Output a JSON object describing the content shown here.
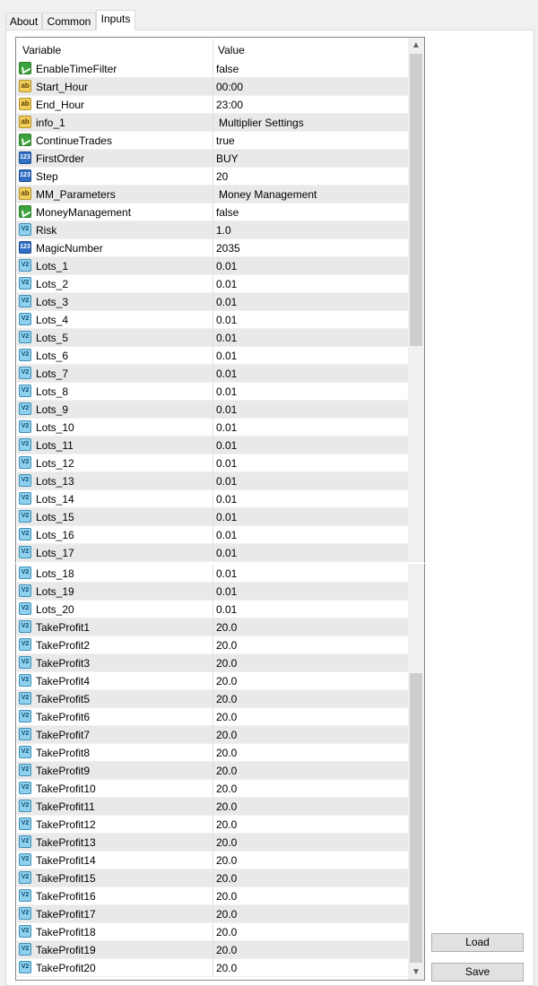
{
  "tabs": [
    {
      "label": "About"
    },
    {
      "label": "Common"
    },
    {
      "label": "Inputs"
    }
  ],
  "table": {
    "columns": [
      "Variable",
      "Value"
    ],
    "rows_top": [
      {
        "name": "EnableTimeFilter",
        "value": "false",
        "icon": "bool-icon"
      },
      {
        "name": "Start_Hour",
        "value": "00:00",
        "icon": "string-icon"
      },
      {
        "name": "End_Hour",
        "value": "23:00",
        "icon": "string-icon"
      },
      {
        "name": "info_1",
        "value": "Multiplier Settings",
        "icon": "string-icon"
      },
      {
        "name": "ContinueTrades",
        "value": "true",
        "icon": "bool-icon"
      },
      {
        "name": "FirstOrder",
        "value": "BUY",
        "icon": "int-icon"
      },
      {
        "name": "Step",
        "value": "20",
        "icon": "int-icon"
      },
      {
        "name": "MM_Parameters",
        "value": "Money Management",
        "icon": "string-icon"
      },
      {
        "name": "MoneyManagement",
        "value": "false",
        "icon": "bool-icon"
      },
      {
        "name": "Risk",
        "value": "1.0",
        "icon": "double-icon"
      },
      {
        "name": "MagicNumber",
        "value": "2035",
        "icon": "int-icon"
      },
      {
        "name": "Lots_1",
        "value": "0.01",
        "icon": "double-icon"
      },
      {
        "name": "Lots_2",
        "value": "0.01",
        "icon": "double-icon"
      },
      {
        "name": "Lots_3",
        "value": "0.01",
        "icon": "double-icon"
      },
      {
        "name": "Lots_4",
        "value": "0.01",
        "icon": "double-icon"
      },
      {
        "name": "Lots_5",
        "value": "0.01",
        "icon": "double-icon"
      },
      {
        "name": "Lots_6",
        "value": "0.01",
        "icon": "double-icon"
      },
      {
        "name": "Lots_7",
        "value": "0.01",
        "icon": "double-icon"
      },
      {
        "name": "Lots_8",
        "value": "0.01",
        "icon": "double-icon"
      },
      {
        "name": "Lots_9",
        "value": "0.01",
        "icon": "double-icon"
      },
      {
        "name": "Lots_10",
        "value": "0.01",
        "icon": "double-icon"
      },
      {
        "name": "Lots_11",
        "value": "0.01",
        "icon": "double-icon"
      },
      {
        "name": "Lots_12",
        "value": "0.01",
        "icon": "double-icon"
      },
      {
        "name": "Lots_13",
        "value": "0.01",
        "icon": "double-icon"
      },
      {
        "name": "Lots_14",
        "value": "0.01",
        "icon": "double-icon"
      },
      {
        "name": "Lots_15",
        "value": "0.01",
        "icon": "double-icon"
      },
      {
        "name": "Lots_16",
        "value": "0.01",
        "icon": "double-icon"
      },
      {
        "name": "Lots_17",
        "value": "0.01",
        "icon": "double-icon"
      }
    ],
    "rows_bottom": [
      {
        "name": "Lots_18",
        "value": "0.01",
        "icon": "double-icon"
      },
      {
        "name": "Lots_19",
        "value": "0.01",
        "icon": "double-icon"
      },
      {
        "name": "Lots_20",
        "value": "0.01",
        "icon": "double-icon"
      },
      {
        "name": "TakeProfit1",
        "value": "20.0",
        "icon": "double-icon"
      },
      {
        "name": "TakeProfit2",
        "value": "20.0",
        "icon": "double-icon"
      },
      {
        "name": "TakeProfit3",
        "value": "20.0",
        "icon": "double-icon"
      },
      {
        "name": "TakeProfit4",
        "value": "20.0",
        "icon": "double-icon"
      },
      {
        "name": "TakeProfit5",
        "value": "20.0",
        "icon": "double-icon"
      },
      {
        "name": "TakeProfit6",
        "value": "20.0",
        "icon": "double-icon"
      },
      {
        "name": "TakeProfit7",
        "value": "20.0",
        "icon": "double-icon"
      },
      {
        "name": "TakeProfit8",
        "value": "20.0",
        "icon": "double-icon"
      },
      {
        "name": "TakeProfit9",
        "value": "20.0",
        "icon": "double-icon"
      },
      {
        "name": "TakeProfit10",
        "value": "20.0",
        "icon": "double-icon"
      },
      {
        "name": "TakeProfit11",
        "value": "20.0",
        "icon": "double-icon"
      },
      {
        "name": "TakeProfit12",
        "value": "20.0",
        "icon": "double-icon"
      },
      {
        "name": "TakeProfit13",
        "value": "20.0",
        "icon": "double-icon"
      },
      {
        "name": "TakeProfit14",
        "value": "20.0",
        "icon": "double-icon"
      },
      {
        "name": "TakeProfit15",
        "value": "20.0",
        "icon": "double-icon"
      },
      {
        "name": "TakeProfit16",
        "value": "20.0",
        "icon": "double-icon"
      },
      {
        "name": "TakeProfit17",
        "value": "20.0",
        "icon": "double-icon"
      },
      {
        "name": "TakeProfit18",
        "value": "20.0",
        "icon": "double-icon"
      },
      {
        "name": "TakeProfit19",
        "value": "20.0",
        "icon": "double-icon"
      },
      {
        "name": "TakeProfit20",
        "value": "20.0",
        "icon": "double-icon"
      }
    ]
  },
  "icon_glyphs": {
    "string-icon": "ab",
    "int-icon": "123",
    "double-icon": "V2",
    "bool-icon": ""
  },
  "buttons": {
    "load_label": "Load",
    "save_label": "Save"
  },
  "scroll_arrows": {
    "up": "▲",
    "down": "▼"
  }
}
